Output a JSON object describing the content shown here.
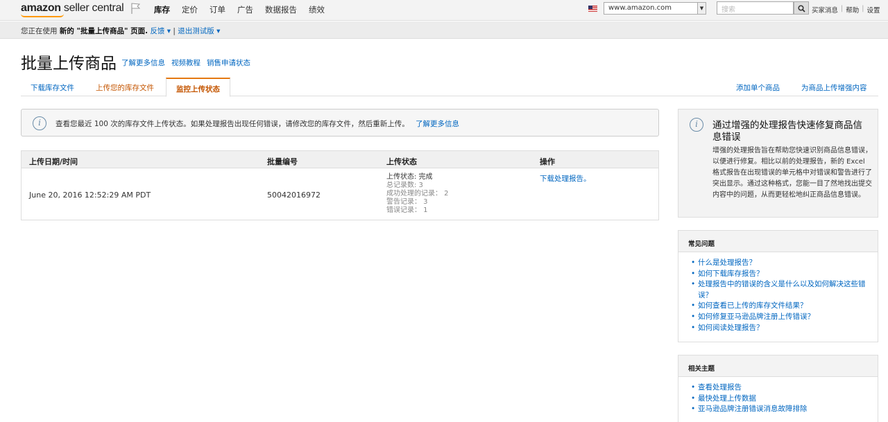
{
  "topnav": {
    "logo_bold": "amazon",
    "logo_rest": " seller central",
    "menu": [
      "库存",
      "定价",
      "订单",
      "广告",
      "数据报告",
      "绩效"
    ],
    "site": "www.amazon.com",
    "search_placeholder": "搜索",
    "links": [
      "买家消息",
      "帮助",
      "设置"
    ]
  },
  "betabar": {
    "prefix": "您正在使用 ",
    "bold": "新的 \"批量上传商品\" 页面.",
    "feedback": "反馈",
    "exit_beta": "退出测试版"
  },
  "page": {
    "title": "批量上传商品",
    "title_links": [
      "了解更多信息",
      "视频教程",
      "销售申请状态"
    ]
  },
  "tabs": {
    "left": [
      "下载库存文件",
      "上传您的库存文件",
      "监控上传状态"
    ],
    "right": [
      "添加单个商品",
      "为商品上传增强内容"
    ]
  },
  "alert": {
    "text": "查看您最近 100 次的库存文件上传状态。如果处理报告出现任何错误，请修改您的库存文件，然后重新上传。",
    "link": "了解更多信息"
  },
  "table": {
    "headers": [
      "上传日期/时间",
      "批量编号",
      "上传状态",
      "操作"
    ],
    "rows": [
      {
        "datetime": "June 20, 2016 12:52:29 AM PDT",
        "batch_id": "50042016972",
        "status_main": "上传状态: 完成",
        "status_lines": [
          "总记录数: 3",
          "成功处理的记录： 2",
          "警告记录： 3",
          "错误记录： 1"
        ],
        "action": "下载处理报告。"
      }
    ]
  },
  "promo": {
    "title": "通过增强的处理报告快速修复商品信息错误",
    "body": "增强的处理报告旨在帮助您快速识别商品信息错误，以便进行修复。相比以前的处理报告，新的 Excel 格式报告在出现错误的单元格中对错误和警告进行了突出显示。通过这种格式，您能一目了然地找出提交内容中的问题，从而更轻松地纠正商品信息错误。"
  },
  "faq": {
    "title": "常见问题",
    "items": [
      "什么是处理报告？",
      "如何下载库存报告？",
      "处理报告中的错误的含义是什么以及如何解决这些错误？",
      "如何查看已上传的库存文件结果？",
      "如何修复亚马逊品牌注册上传错误？",
      "如何阅读处理报告？"
    ]
  },
  "related": {
    "title": "相关主题",
    "items": [
      "查看处理报告",
      "最快处理上传数据",
      "亚马逊品牌注册错误消息故障排除"
    ]
  }
}
